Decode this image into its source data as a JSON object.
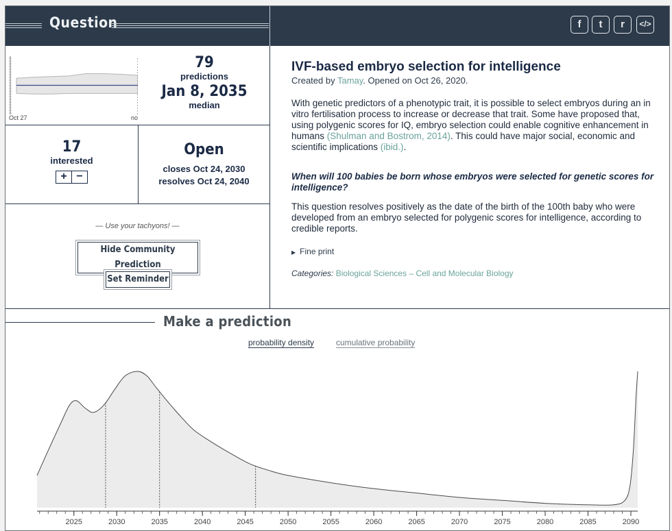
{
  "header": {
    "title": "Question",
    "share_icons": [
      {
        "name": "facebook-icon",
        "glyph": "f"
      },
      {
        "name": "twitter-icon",
        "glyph": "t"
      },
      {
        "name": "reddit-icon",
        "glyph": "r"
      },
      {
        "name": "embed-icon",
        "glyph": "</>"
      }
    ]
  },
  "mini_chart": {
    "start_label": "Oct 27",
    "end_label": "now"
  },
  "stats": {
    "predictions_count": "79",
    "predictions_label": "predictions",
    "median_value": "Jan 8, 2035",
    "median_label": "median",
    "interested_count": "17",
    "interested_label": "interested",
    "plus_label": "+",
    "minus_label": "−",
    "status": "Open",
    "closes": "closes Oct 24, 2030",
    "resolves": "resolves Oct 24, 2040"
  },
  "actions": {
    "tachyons_hint": "— Use your tachyons! —",
    "hide_community": "Hide Community Prediction",
    "set_reminder": "Set Reminder"
  },
  "question": {
    "title": "IVF-based embryo selection for intelligence",
    "created_by_prefix": "Created by ",
    "author": "Tamay",
    "opened": ". Opened on Oct 26, 2020.",
    "body1_a": "With genetic predictors of a phenotypic trait, it is possible to select embryos during an in vitro fertilisation process to increase or decrease that trait. Some have proposed that, using polygenic scores for IQ, embryo selection could enable cognitive enhancement in humans ",
    "body1_link1": "(Shulman and Bostrom, 2014)",
    "body1_b": ". This could have major social, economic and scientific implications ",
    "body1_link2": "(ibid.)",
    "body1_c": ".",
    "question_text": "When will 100 babies be born whose embryos were selected for genetic scores for intelligence?",
    "resolution": "This question resolves positively as the date of the birth of the 100th baby who were developed from an embryo selected for polygenic scores for intelligence, according to credible reports.",
    "fine_print": "Fine print",
    "categories_label": "Categories:",
    "categories_value": "Biological Sciences – Cell and Molecular Biology"
  },
  "prediction": {
    "section_title": "Make a prediction",
    "tab_density": "probability density",
    "tab_cumulative": "cumulative probability"
  },
  "chart_data": {
    "type": "area",
    "title": "",
    "xlabel": "",
    "ylabel": "",
    "xlim": [
      2020.7,
      2090.8
    ],
    "x_ticks": [
      2025,
      2030,
      2035,
      2040,
      2045,
      2050,
      2055,
      2060,
      2065,
      2070,
      2075,
      2080,
      2085,
      2090
    ],
    "x": [
      2020.7,
      2022,
      2023.5,
      2024.5,
      2025.3,
      2026.3,
      2027.3,
      2028.5,
      2029.8,
      2031,
      2032.4,
      2033.5,
      2034.6,
      2036,
      2037.5,
      2039,
      2041,
      2043,
      2045.5,
      2048,
      2050,
      2055,
      2060,
      2065,
      2070,
      2075,
      2080,
      2085,
      2088,
      2089.3,
      2089.9,
      2090.3,
      2090.6,
      2090.8
    ],
    "y": [
      0.22,
      0.39,
      0.58,
      0.7,
      0.73,
      0.68,
      0.65,
      0.7,
      0.81,
      0.9,
      0.93,
      0.9,
      0.82,
      0.72,
      0.62,
      0.53,
      0.45,
      0.38,
      0.3,
      0.25,
      0.22,
      0.17,
      0.13,
      0.1,
      0.07,
      0.05,
      0.03,
      0.02,
      0.02,
      0.05,
      0.15,
      0.4,
      0.75,
      0.93
    ],
    "markers": [
      {
        "label": "lower quartile",
        "x": 2028.7
      },
      {
        "label": "median",
        "x": 2035.0
      },
      {
        "label": "upper quartile",
        "x": 2046.2
      }
    ],
    "mini_series": {
      "median": [
        0.5,
        0.5,
        0.5,
        0.5,
        0.5,
        0.5,
        0.5,
        0.5
      ],
      "upper": [
        0.62,
        0.64,
        0.65,
        0.66,
        0.7,
        0.7,
        0.69,
        0.67
      ],
      "lower": [
        0.36,
        0.35,
        0.35,
        0.36,
        0.36,
        0.36,
        0.36,
        0.36
      ]
    }
  },
  "colors": {
    "navy": "#2c3a4a",
    "accent_link": "#6aa39a",
    "area_fill": "#ececec"
  }
}
